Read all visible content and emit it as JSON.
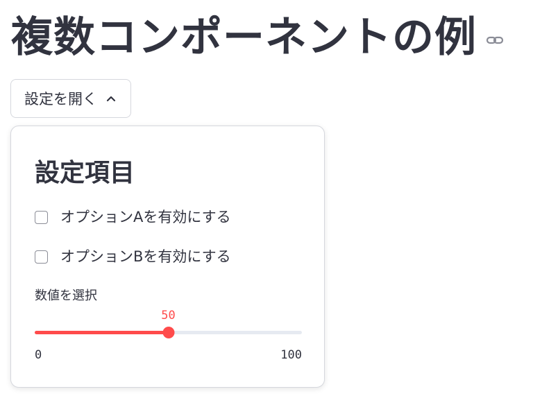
{
  "page": {
    "title": "複数コンポーネントの例"
  },
  "popover": {
    "button_label": "設定を開く",
    "expanded": true,
    "heading": "設定項目",
    "checkboxes": [
      {
        "label": "オプションAを有効にする",
        "checked": false
      },
      {
        "label": "オプションBを有効にする",
        "checked": false
      }
    ],
    "slider": {
      "label": "数値を選択",
      "value": 50,
      "value_text": "50",
      "min": 0,
      "max": 100,
      "min_text": "0",
      "max_text": "100"
    }
  },
  "icons": {
    "title_anchor": "link-icon",
    "trigger": "chevron-up-icon"
  },
  "colors": {
    "text": "#31333f",
    "accent": "#ff4b4b",
    "border": "#d5d7dd",
    "track": "#e6eaf1"
  }
}
